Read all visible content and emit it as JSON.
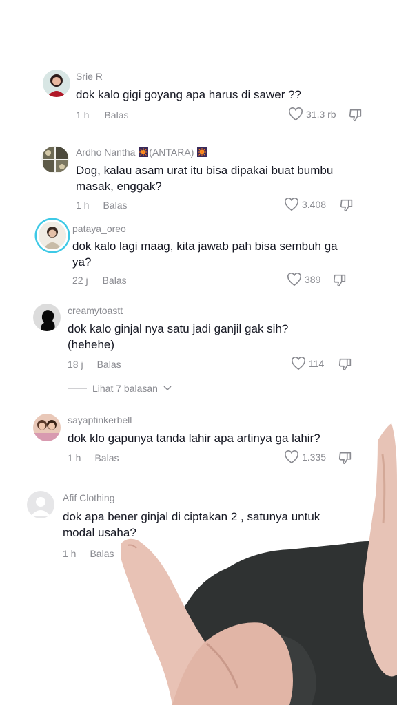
{
  "comments": [
    {
      "username": "Srie R",
      "text": "dok kalo gigi goyang apa harus di sawer ??",
      "time": "1 h",
      "reply": "Balas",
      "likes": "31,3 rb"
    },
    {
      "username": "Ardho Nantha",
      "username_suffix": "(ANTARA)",
      "text": "Dog, kalau asam urat itu bisa dipakai buat bumbu masak, enggak?",
      "time": "1 h",
      "reply": "Balas",
      "likes": "3.408"
    },
    {
      "username": "pataya_oreo",
      "text": "dok kalo lagi maag, kita jawab pah bisa sembuh ga ya?",
      "time": "22 j",
      "reply": "Balas",
      "likes": "389"
    },
    {
      "username": "creamytoastt",
      "text": "dok kalo ginjal nya satu jadi ganjil gak sih? (hehehe)",
      "time": "18 j",
      "reply": "Balas",
      "likes": "114"
    },
    {
      "username": "sayaptinkerbell",
      "text": "dok klo gapunya tanda lahir apa artinya ga lahir?",
      "time": "1 h",
      "reply": "Balas",
      "likes": "1.335"
    },
    {
      "username": "Afif Clothing",
      "text": "dok apa bener ginjal di ciptakan 2 , satunya untuk modal usaha?",
      "time": "1 h",
      "reply": "Balas"
    }
  ],
  "view_replies": "Lihat 7 balasan",
  "icons": {
    "like": "heart-outline-icon",
    "dislike": "thumbs-down-icon",
    "expand": "chevron-down-icon",
    "emoji": "firework-emoji-icon"
  },
  "colors": {
    "text": "#161823",
    "muted": "#8a8b91",
    "story_ring": "#3ec9e6"
  }
}
